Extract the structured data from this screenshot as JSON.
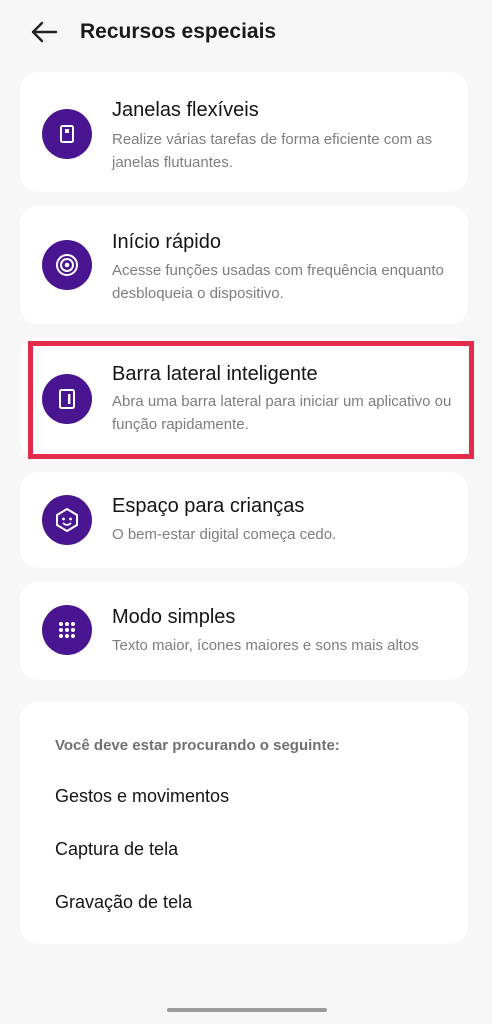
{
  "header": {
    "title": "Recursos especiais",
    "back_icon": "arrow-left-icon"
  },
  "features": [
    {
      "title": "Janelas flexíveis",
      "description": "Realize várias tarefas de forma eficiente com as janelas flutuantes.",
      "icon": "flexible-window-icon"
    },
    {
      "title": "Início rápido",
      "description": "Acesse funções usadas com frequência enquanto desbloqueia o dispositivo.",
      "icon": "quick-launch-icon"
    },
    {
      "title": "Barra lateral inteligente",
      "description": "Abra uma barra lateral para iniciar um aplicativo ou função rapidamente.",
      "icon": "smart-sidebar-icon",
      "highlighted": true
    },
    {
      "title": "Espaço para crianças",
      "description": "O bem-estar digital começa cedo.",
      "icon": "kids-face-icon"
    },
    {
      "title": "Modo simples",
      "description": "Texto maior, ícones maiores e sons mais altos",
      "icon": "grid-dots-icon"
    }
  ],
  "suggestions": {
    "heading": "Você deve estar procurando o seguinte:",
    "items": [
      "Gestos e movimentos",
      "Captura de tela",
      "Gravação de tela"
    ]
  },
  "colors": {
    "icon_background": "#4a1590",
    "highlight_border": "#e32c4b",
    "page_background": "#f7f7f7",
    "card_background": "#ffffff"
  }
}
